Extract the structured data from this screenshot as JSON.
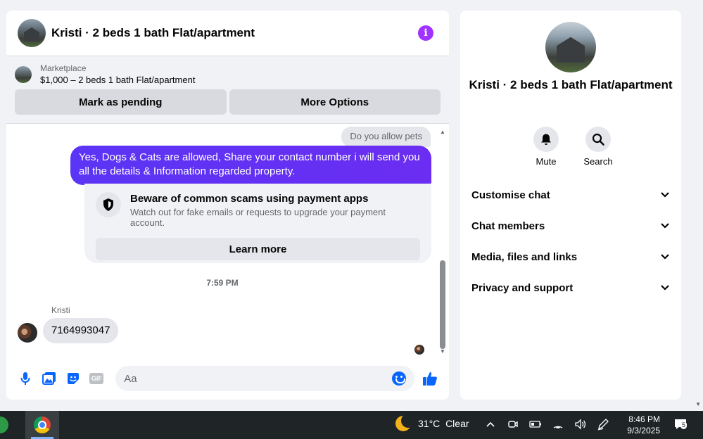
{
  "header": {
    "title": "Kristi · 2 beds 1 bath Flat/apartment"
  },
  "listing": {
    "label": "Marketplace",
    "price_title": "$1,000 – 2 beds 1 bath Flat/apartment",
    "mark_pending_label": "Mark as pending",
    "more_options_label": "More Options"
  },
  "messages": {
    "incoming_partial": "Do you allow pets",
    "outgoing_text": "Yes, Dogs & Cats are allowed, Share your contact number i will send you all the details & Information regarded property.",
    "scam_title": "Beware of common scams using payment apps",
    "scam_desc": "Watch out for fake emails or requests to upgrade your payment account.",
    "learn_more_label": "Learn more",
    "timestamp": "7:59 PM",
    "sender_name": "Kristi",
    "incoming_text": "7164993047"
  },
  "composer": {
    "placeholder": "Aa"
  },
  "info": {
    "title": "Kristi · 2 beds 1 bath Flat/apartment",
    "mute_label": "Mute",
    "search_label": "Search",
    "sections": [
      "Customise chat",
      "Chat members",
      "Media, files and links",
      "Privacy and support"
    ]
  },
  "taskbar": {
    "weather_temp": "31°C",
    "weather_desc": "Clear",
    "time": "8:46 PM",
    "date": "9/3/2025",
    "notification_count": "5"
  },
  "colors": {
    "accent": "#0866ff",
    "outgoing_bubble": "#6b2df2",
    "info_icon": "#a033ff"
  }
}
